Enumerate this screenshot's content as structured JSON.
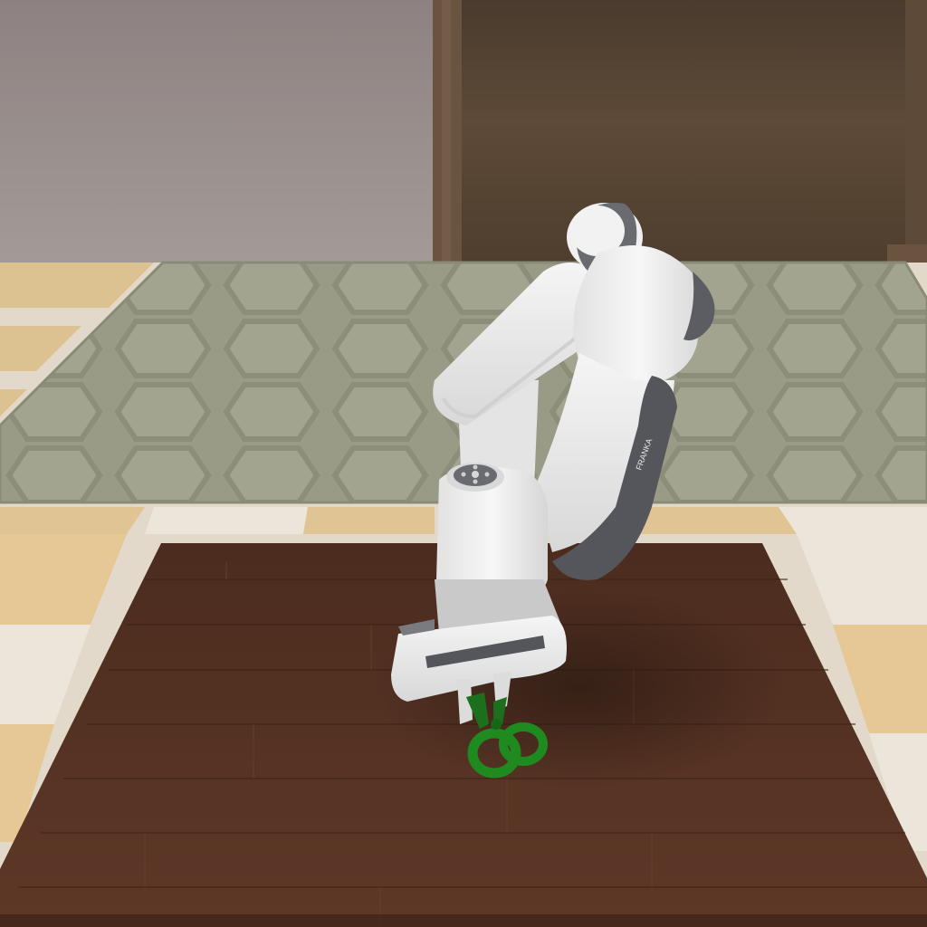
{
  "scene": {
    "robot_brand_text": "FRANKA",
    "held_object": "scissors",
    "colors": {
      "wall": "#968b89",
      "cabinet": "#5a4836",
      "rug": "#9c9d88",
      "tile_light": "#e6ddd0",
      "tile_tan": "#e0c493",
      "wood_table": "#5a3424",
      "robot_white": "#eeeeee",
      "robot_dark": "#55565b",
      "scissors_green": "#1f8a1f"
    }
  }
}
